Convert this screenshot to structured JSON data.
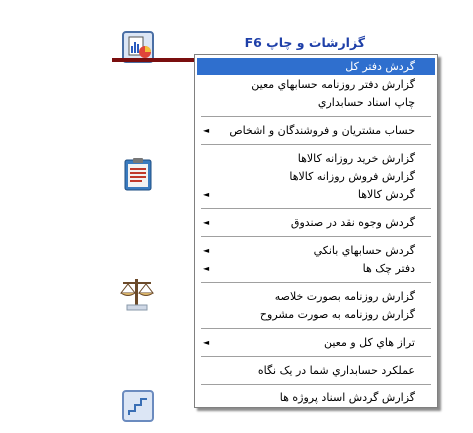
{
  "toolbar": {
    "title": "گزارشات و چاپ  F6",
    "title_color": "#1e3fa8",
    "icons": [
      "reports-chart-icon",
      "clipboard-icon",
      "scales-icon",
      "stairs-icon"
    ]
  },
  "menu": {
    "items": [
      {
        "label": "گردش دفتر كل",
        "selected": true,
        "submenu": false
      },
      {
        "label": "گزارش دفتر روزنامه حسابهاي معين",
        "selected": false,
        "submenu": false
      },
      {
        "label": "چاپ اسناد حسابداري",
        "selected": false,
        "submenu": false
      },
      {
        "label": "حساب مشتريان و فروشندگان و اشخاص",
        "selected": false,
        "submenu": true
      },
      {
        "label": "گزارش خريد روزانه كالاها",
        "selected": false,
        "submenu": false
      },
      {
        "label": "گزارش فروش روزانه كالاها",
        "selected": false,
        "submenu": false
      },
      {
        "label": "گردش كالاها",
        "selected": false,
        "submenu": true
      },
      {
        "label": "گردش وجوه نقد در صندوق",
        "selected": false,
        "submenu": true
      },
      {
        "label": "گردش حسابهاي بانكي",
        "selected": false,
        "submenu": true
      },
      {
        "label": "دفتر چک ها",
        "selected": false,
        "submenu": true
      },
      {
        "label": "گزارش روزنامه بصورت خلاصه",
        "selected": false,
        "submenu": false
      },
      {
        "label": "گزارش روزنامه به صورت مشروح",
        "selected": false,
        "submenu": false
      },
      {
        "label": "تراز هاي كل و معين",
        "selected": false,
        "submenu": true
      },
      {
        "label": "عملكرد حسابداري شما در يک نگاه",
        "selected": false,
        "submenu": false
      },
      {
        "label": "گزارش گردش اسناد پروژه ها",
        "selected": false,
        "submenu": false
      }
    ],
    "selection_color": "#2f6fce"
  }
}
